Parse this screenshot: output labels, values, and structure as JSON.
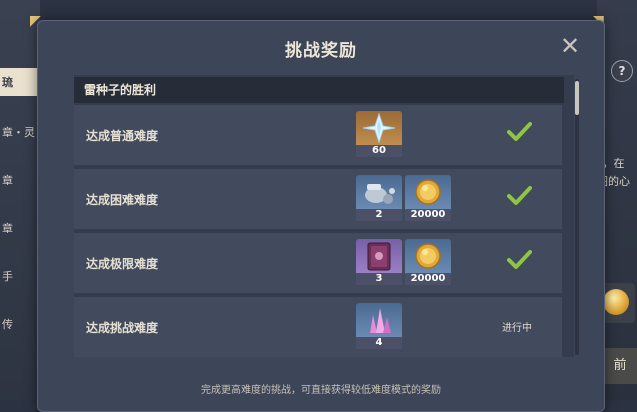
{
  "background": {
    "left_items": [
      "琉",
      "章・灵",
      "章",
      "章",
      "手",
      "传"
    ],
    "right_fragments": [
      "」，在",
      "图的心"
    ],
    "help_symbol": "?",
    "right_button_fragment": "前"
  },
  "modal": {
    "title": "挑战奖励",
    "close_symbol": "✕",
    "section_title": "雷种子的胜利",
    "footer_note": "完成更高难度的挑战，可直接获得较低难度模式的奖励",
    "rows": [
      {
        "label": "达成普通难度",
        "rewards": [
          {
            "icon": "primogem-icon",
            "count": "60"
          }
        ],
        "status": "completed"
      },
      {
        "label": "达成困难难度",
        "rewards": [
          {
            "icon": "mystic-enhancement-ore-icon",
            "count": "2"
          },
          {
            "icon": "mora-coin-icon",
            "count": "20000"
          }
        ],
        "status": "completed"
      },
      {
        "label": "达成极限难度",
        "rewards": [
          {
            "icon": "talent-book-icon",
            "count": "3"
          },
          {
            "icon": "mora-coin-icon",
            "count": "20000"
          }
        ],
        "status": "completed"
      },
      {
        "label": "达成挑战难度",
        "rewards": [
          {
            "icon": "crystal-icon",
            "count": "4"
          }
        ],
        "status": "进行中"
      }
    ]
  },
  "colors": {
    "check": "#8fc63f",
    "accent": "#e9c77a"
  }
}
